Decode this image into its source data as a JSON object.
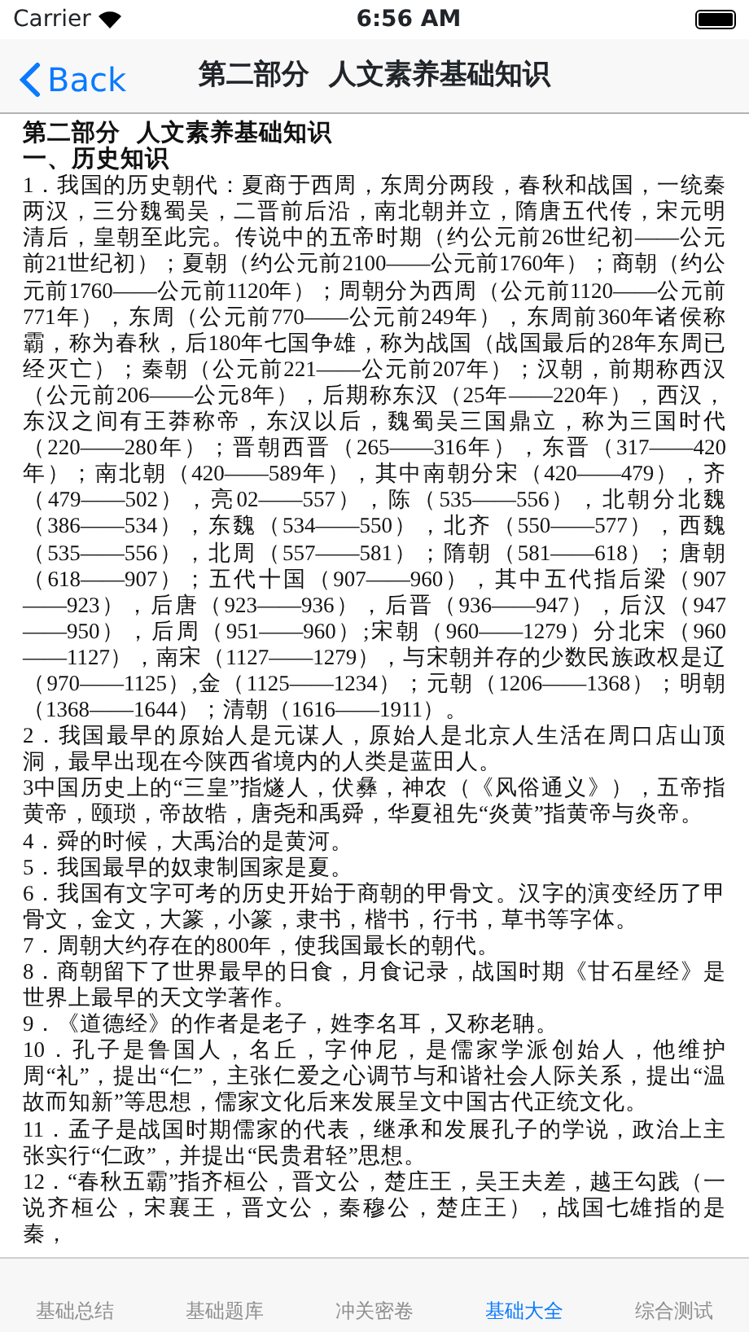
{
  "status_bar": {
    "carrier": "Carrier",
    "time": "6:56 AM"
  },
  "nav_bar": {
    "back": "Back",
    "title": "第二部分  人文素养基础知识"
  },
  "content": {
    "headings": [
      "第二部分  人文素养基础知识",
      "一、历史知识"
    ],
    "paragraphs": [
      "1．我国的历史朝代：夏商于西周，东周分两段，春秋和战国，一统秦两汉，三分魏蜀吴，二晋前后沿，南北朝并立，隋唐五代传，宋元明清后，皇朝至此完。传说中的五帝时期（约公元前26世纪初——公元前21世纪初）；夏朝（约公元前2100——公元前1760年）；商朝（约公元前1760——公元前1120年）；周朝分为西周（公元前1120——公元前771年），东周（公元前770——公元前249年），东周前360年诸侯称霸，称为春秋，后180年七国争雄，称为战国（战国最后的28年东周已经灭亡）；秦朝（公元前221——公元前207年）；汉朝，前期称西汉（公元前206——公元8年），后期称东汉（25年——220年），西汉，东汉之间有王莽称帝，东汉以后，魏蜀吴三国鼎立，称为三国时代（220——280年）；晋朝西晋（265——316年），东晋（317——420年）；南北朝（420——589年），其中南朝分宋（420——479），齐（479——502），亮02——557），陈（535——556），北朝分北魏（386——534），东魏（534——550），北齐（550——577），西魏（535——556），北周（557——581）；隋朝（581——618）；唐朝（618——907）；五代十国（907——960），其中五代指后梁（907——923），后唐（923——936），后晋（936——947），后汉（947——950），后周（951——960）;宋朝（960——1279）分北宋（960——1127），南宋（1127——1279），与宋朝并存的少数民族政权是辽（970——1125）,金（1125——1234）；元朝（1206——1368）；明朝（1368——1644）；清朝（1616——1911）。",
      "2．我国最早的原始人是元谋人，原始人是北京人生活在周口店山顶洞，最早出现在今陕西省境内的人类是蓝田人。",
      "3中国历史上的“三皇”指燧人，伏彝，神农（《风俗通义》），五帝指黄帝，颐琐，帝故牿，唐尧和禹舜，华夏祖先“炎黄”指黄帝与炎帝。",
      "4．舜的时候，大禹治的是黄河。",
      "5．我国最早的奴隶制国家是夏。",
      "6．我国有文字可考的历史开始于商朝的甲骨文。汉字的演变经历了甲骨文，金文，大篆，小篆，隶书，楷书，行书，草书等字体。",
      "7．周朝大约存在的800年，使我国最长的朝代。",
      "8．商朝留下了世界最早的日食，月食记录，战国时期《甘石星经》是世界上最早的天文学著作。",
      "9．《道德经》的作者是老子，姓李名耳，又称老聃。",
      "10．孔子是鲁国人，名丘，字仲尼，是儒家学派创始人，他维护周“礼”，提出“仁”，主张仁爱之心调节与和谐社会人际关系，提出“温故而知新”等思想，儒家文化后来发展呈文中国古代正统文化。",
      "11．孟子是战国时期儒家的代表，继承和发展孔子的学说，政治上主张实行“仁政”，并提出“民贵君轻”思想。",
      "12．“春秋五霸”指齐桓公，晋文公，楚庄王，吴王夫差，越王勾践（一说齐桓公，宋襄王，晋文公，秦穆公，楚庄王），战国七雄指的是秦，"
    ]
  },
  "tab_bar": [
    {
      "label": "基础总结",
      "selected": false
    },
    {
      "label": "基础题库",
      "selected": false
    },
    {
      "label": "冲关密卷",
      "selected": false
    },
    {
      "label": "基础大全",
      "selected": true
    },
    {
      "label": "综合测试",
      "selected": false
    }
  ]
}
